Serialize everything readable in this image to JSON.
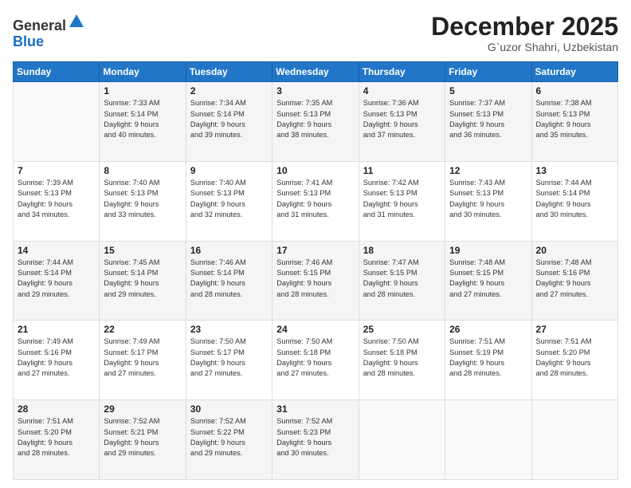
{
  "header": {
    "logo_general": "General",
    "logo_blue": "Blue",
    "month_title": "December 2025",
    "location": "G`uzor Shahri, Uzbekistan"
  },
  "calendar": {
    "days_of_week": [
      "Sunday",
      "Monday",
      "Tuesday",
      "Wednesday",
      "Thursday",
      "Friday",
      "Saturday"
    ],
    "weeks": [
      [
        {
          "day": "",
          "info": ""
        },
        {
          "day": "1",
          "info": "Sunrise: 7:33 AM\nSunset: 5:14 PM\nDaylight: 9 hours\nand 40 minutes."
        },
        {
          "day": "2",
          "info": "Sunrise: 7:34 AM\nSunset: 5:14 PM\nDaylight: 9 hours\nand 39 minutes."
        },
        {
          "day": "3",
          "info": "Sunrise: 7:35 AM\nSunset: 5:13 PM\nDaylight: 9 hours\nand 38 minutes."
        },
        {
          "day": "4",
          "info": "Sunrise: 7:36 AM\nSunset: 5:13 PM\nDaylight: 9 hours\nand 37 minutes."
        },
        {
          "day": "5",
          "info": "Sunrise: 7:37 AM\nSunset: 5:13 PM\nDaylight: 9 hours\nand 36 minutes."
        },
        {
          "day": "6",
          "info": "Sunrise: 7:38 AM\nSunset: 5:13 PM\nDaylight: 9 hours\nand 35 minutes."
        }
      ],
      [
        {
          "day": "7",
          "info": "Sunrise: 7:39 AM\nSunset: 5:13 PM\nDaylight: 9 hours\nand 34 minutes."
        },
        {
          "day": "8",
          "info": "Sunrise: 7:40 AM\nSunset: 5:13 PM\nDaylight: 9 hours\nand 33 minutes."
        },
        {
          "day": "9",
          "info": "Sunrise: 7:40 AM\nSunset: 5:13 PM\nDaylight: 9 hours\nand 32 minutes."
        },
        {
          "day": "10",
          "info": "Sunrise: 7:41 AM\nSunset: 5:13 PM\nDaylight: 9 hours\nand 31 minutes."
        },
        {
          "day": "11",
          "info": "Sunrise: 7:42 AM\nSunset: 5:13 PM\nDaylight: 9 hours\nand 31 minutes."
        },
        {
          "day": "12",
          "info": "Sunrise: 7:43 AM\nSunset: 5:13 PM\nDaylight: 9 hours\nand 30 minutes."
        },
        {
          "day": "13",
          "info": "Sunrise: 7:44 AM\nSunset: 5:14 PM\nDaylight: 9 hours\nand 30 minutes."
        }
      ],
      [
        {
          "day": "14",
          "info": "Sunrise: 7:44 AM\nSunset: 5:14 PM\nDaylight: 9 hours\nand 29 minutes."
        },
        {
          "day": "15",
          "info": "Sunrise: 7:45 AM\nSunset: 5:14 PM\nDaylight: 9 hours\nand 29 minutes."
        },
        {
          "day": "16",
          "info": "Sunrise: 7:46 AM\nSunset: 5:14 PM\nDaylight: 9 hours\nand 28 minutes."
        },
        {
          "day": "17",
          "info": "Sunrise: 7:46 AM\nSunset: 5:15 PM\nDaylight: 9 hours\nand 28 minutes."
        },
        {
          "day": "18",
          "info": "Sunrise: 7:47 AM\nSunset: 5:15 PM\nDaylight: 9 hours\nand 28 minutes."
        },
        {
          "day": "19",
          "info": "Sunrise: 7:48 AM\nSunset: 5:15 PM\nDaylight: 9 hours\nand 27 minutes."
        },
        {
          "day": "20",
          "info": "Sunrise: 7:48 AM\nSunset: 5:16 PM\nDaylight: 9 hours\nand 27 minutes."
        }
      ],
      [
        {
          "day": "21",
          "info": "Sunrise: 7:49 AM\nSunset: 5:16 PM\nDaylight: 9 hours\nand 27 minutes."
        },
        {
          "day": "22",
          "info": "Sunrise: 7:49 AM\nSunset: 5:17 PM\nDaylight: 9 hours\nand 27 minutes."
        },
        {
          "day": "23",
          "info": "Sunrise: 7:50 AM\nSunset: 5:17 PM\nDaylight: 9 hours\nand 27 minutes."
        },
        {
          "day": "24",
          "info": "Sunrise: 7:50 AM\nSunset: 5:18 PM\nDaylight: 9 hours\nand 27 minutes."
        },
        {
          "day": "25",
          "info": "Sunrise: 7:50 AM\nSunset: 5:18 PM\nDaylight: 9 hours\nand 28 minutes."
        },
        {
          "day": "26",
          "info": "Sunrise: 7:51 AM\nSunset: 5:19 PM\nDaylight: 9 hours\nand 28 minutes."
        },
        {
          "day": "27",
          "info": "Sunrise: 7:51 AM\nSunset: 5:20 PM\nDaylight: 9 hours\nand 28 minutes."
        }
      ],
      [
        {
          "day": "28",
          "info": "Sunrise: 7:51 AM\nSunset: 5:20 PM\nDaylight: 9 hours\nand 28 minutes."
        },
        {
          "day": "29",
          "info": "Sunrise: 7:52 AM\nSunset: 5:21 PM\nDaylight: 9 hours\nand 29 minutes."
        },
        {
          "day": "30",
          "info": "Sunrise: 7:52 AM\nSunset: 5:22 PM\nDaylight: 9 hours\nand 29 minutes."
        },
        {
          "day": "31",
          "info": "Sunrise: 7:52 AM\nSunset: 5:23 PM\nDaylight: 9 hours\nand 30 minutes."
        },
        {
          "day": "",
          "info": ""
        },
        {
          "day": "",
          "info": ""
        },
        {
          "day": "",
          "info": ""
        }
      ]
    ]
  }
}
